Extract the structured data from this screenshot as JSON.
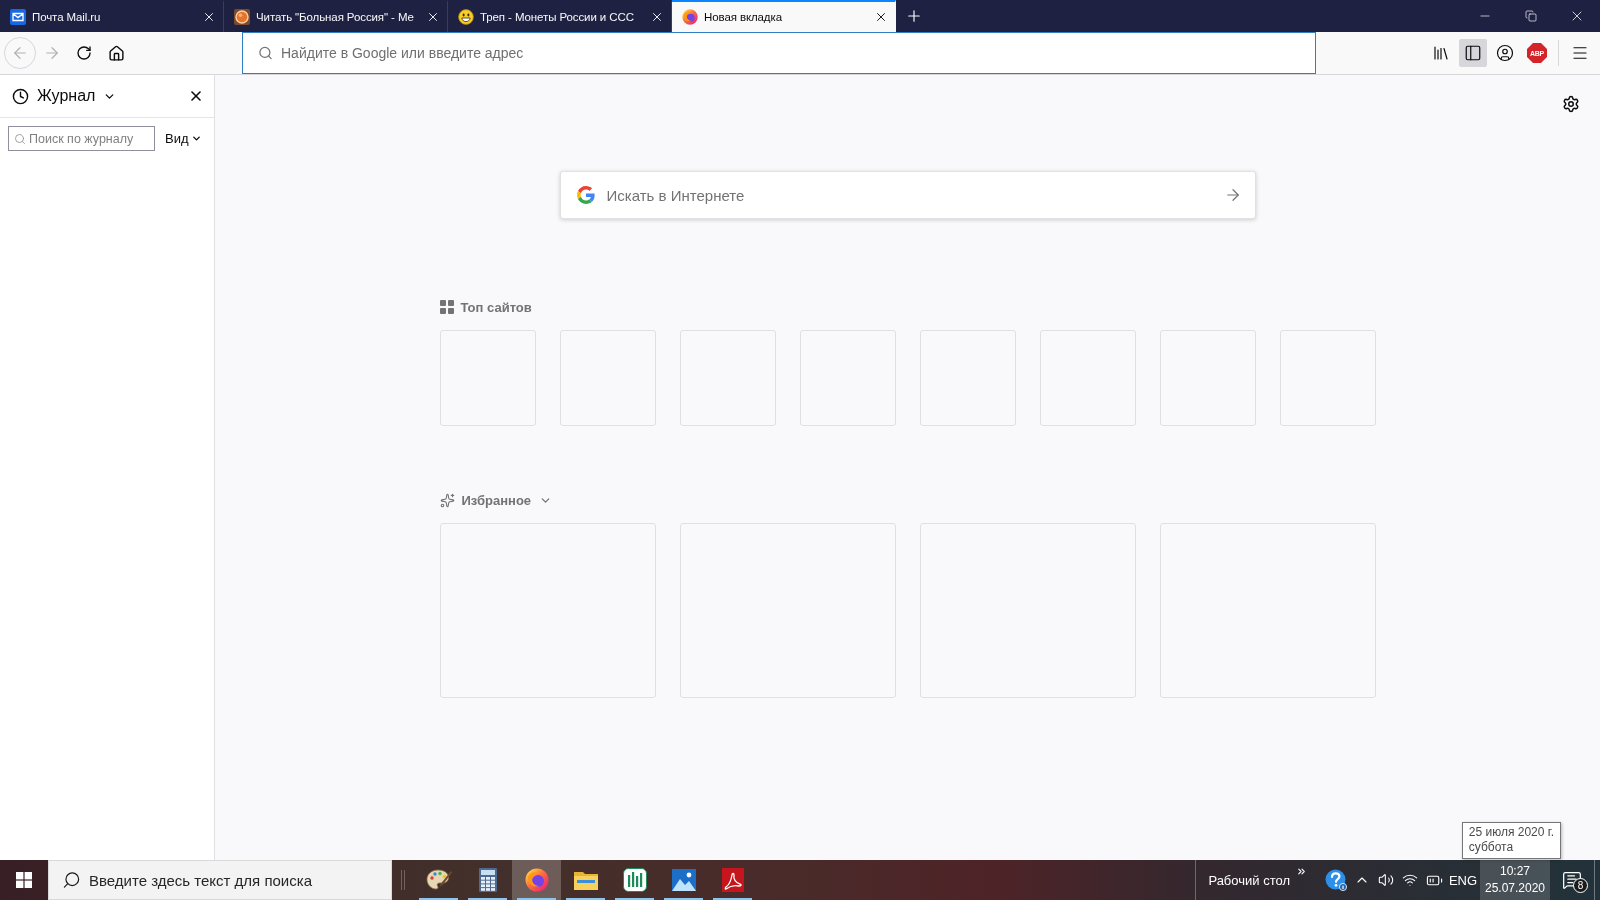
{
  "tabs": [
    {
      "title": "Почта Mail.ru",
      "selected": false
    },
    {
      "title": "Читать \"Больная Россия\" - Ме",
      "selected": false
    },
    {
      "title": "Треп - Монеты России и ССС",
      "selected": false
    },
    {
      "title": "Новая вкладка",
      "selected": true
    }
  ],
  "toolbar": {
    "back": {
      "disabled": true
    },
    "forward": {
      "disabled": true
    },
    "address": {
      "placeholder": "Найдите в Google или введите адрес",
      "focused": true
    },
    "sidebar_toggle": {
      "on": true
    },
    "extension_badge": "ABP"
  },
  "sidebar": {
    "title": "Журнал",
    "search": {
      "placeholder": "Поиск по журналу"
    },
    "view_button": "Вид"
  },
  "new_tab": {
    "search": {
      "placeholder": "Искать в Интернете"
    },
    "top_sites": {
      "title": "Топ сайтов",
      "tiles": [
        {
          "kind": "empty"
        },
        {
          "kind": "empty"
        },
        {
          "kind": "empty"
        },
        {
          "kind": "empty"
        },
        {
          "kind": "empty"
        },
        {
          "kind": "empty"
        },
        {
          "kind": "empty"
        },
        {
          "kind": "empty"
        }
      ]
    },
    "highlights": {
      "title": "Избранное",
      "expanded": true,
      "cards": [
        {
          "kind": "empty"
        },
        {
          "kind": "empty"
        },
        {
          "kind": "empty"
        },
        {
          "kind": "empty"
        }
      ]
    }
  },
  "tooltip": {
    "lines": [
      "25 июля 2020 г.",
      "суббота"
    ]
  },
  "taskbar": {
    "search": {
      "placeholder": "Введите здесь текст для поиска"
    },
    "apps": [
      {
        "selected": false,
        "running": true
      },
      {
        "selected": false,
        "running": true
      },
      {
        "selected": true,
        "running": true
      },
      {
        "selected": false,
        "running": true
      },
      {
        "selected": false,
        "running": true
      },
      {
        "selected": false,
        "running": true
      },
      {
        "selected": false,
        "running": true
      }
    ],
    "desktop_toolbar": "Рабочий стол",
    "language": "ENG",
    "clock": {
      "time": "10:27",
      "date": "25.07.2020",
      "highlighted": true
    },
    "notifications": {
      "count": "8"
    }
  }
}
